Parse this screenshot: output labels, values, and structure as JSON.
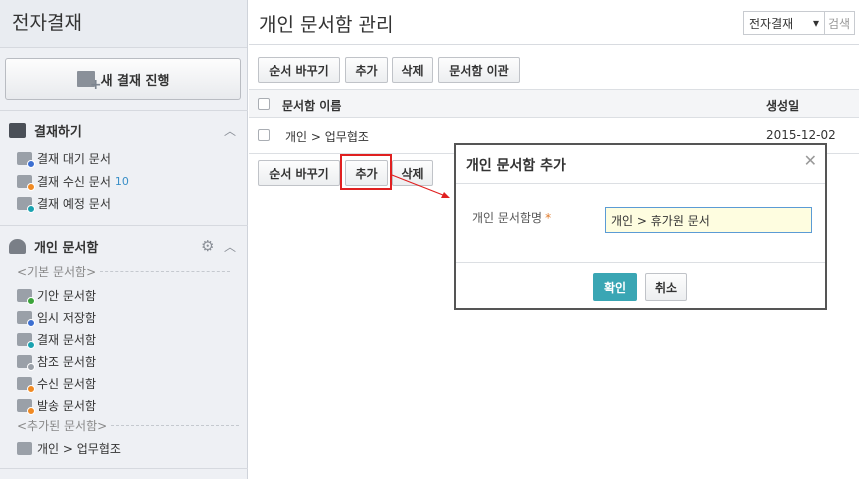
{
  "sidebar": {
    "title": "전자결재",
    "new_button": "새 결재 진행",
    "approval": {
      "heading": "결재하기",
      "items": [
        {
          "label": "결재 대기 문서",
          "icon": "clock-doc-icon"
        },
        {
          "label": "결재 수신 문서",
          "count": "10",
          "icon": "inbox-doc-icon"
        },
        {
          "label": "결재 예정 문서",
          "icon": "person-doc-icon"
        }
      ]
    },
    "personal": {
      "heading": "개인 문서함",
      "basic_group": "<기본 문서함>",
      "basic_items": [
        {
          "label": "기안 문서함",
          "color": "#3ba43b"
        },
        {
          "label": "임시 저장함",
          "color": "#3c6fd1"
        },
        {
          "label": "결재 문서함",
          "color": "#1aa2b0"
        },
        {
          "label": "참조 문서함",
          "color": "#9aa0a8"
        },
        {
          "label": "수신 문서함",
          "color": "#f08a24"
        },
        {
          "label": "발송 문서함",
          "color": "#f08a24"
        }
      ],
      "added_group": "<추가된 문서함>",
      "added_items": [
        {
          "label": "개인 > 업무협조"
        }
      ]
    }
  },
  "main": {
    "title": "개인 문서함 관리",
    "filter_select": "전자결재",
    "search_placeholder": "검색",
    "toolbar": {
      "reorder": "순서 바꾸기",
      "add": "추가",
      "delete": "삭제",
      "move": "문서함 이관"
    },
    "table": {
      "headers": [
        "문서함 이름",
        "생성일"
      ],
      "rows": [
        {
          "name": "개인 > 업무협조",
          "date": "2015-12-02"
        }
      ]
    }
  },
  "dialog": {
    "title": "개인 문서함 추가",
    "field_label": "개인 문서함명",
    "required_mark": "*",
    "field_value": "개인 > 휴가원 문서",
    "ok": "확인",
    "cancel": "취소"
  },
  "colors": {
    "accent": "#3aa6b4",
    "highlight": "#e02020",
    "count": "#3a8fc7"
  }
}
